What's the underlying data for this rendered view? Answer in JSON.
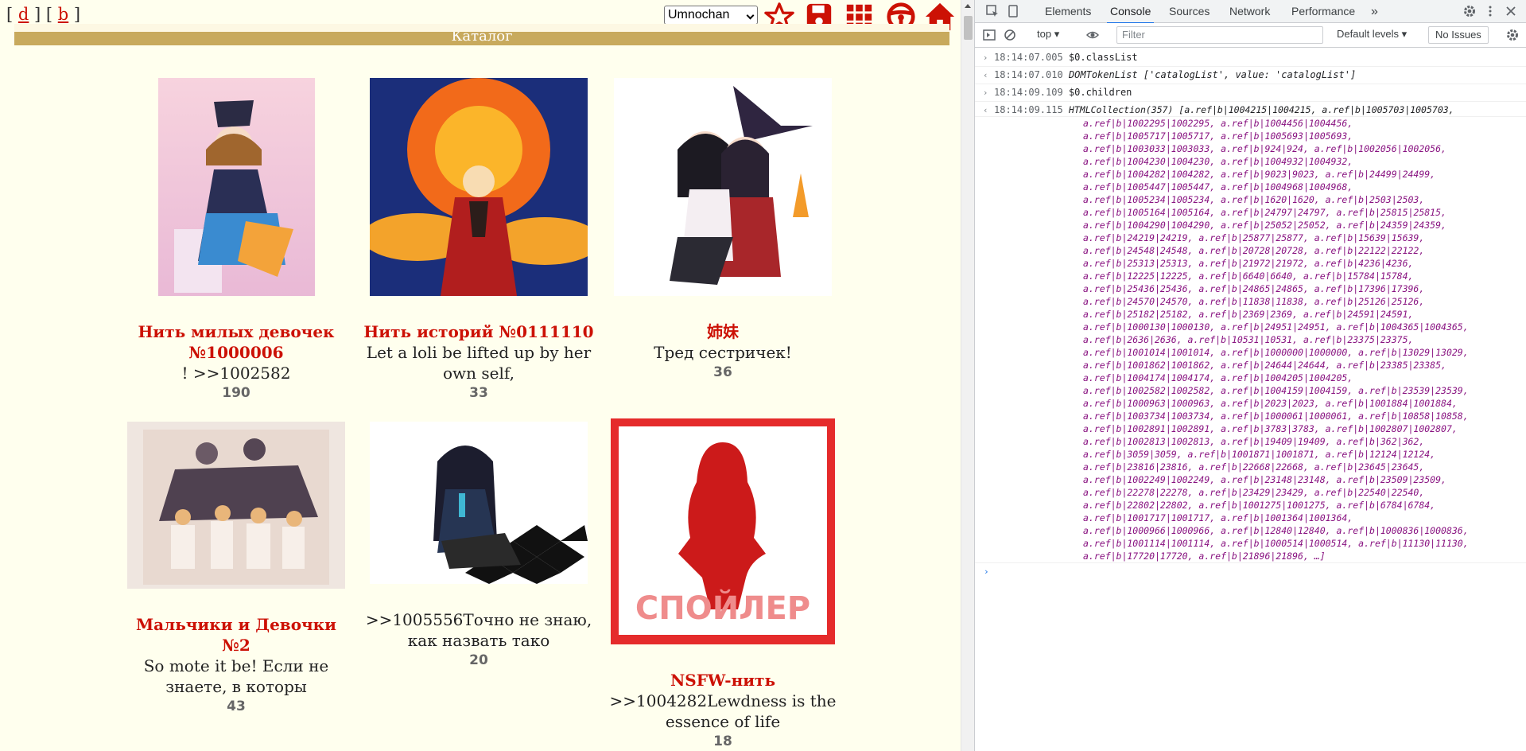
{
  "board": {
    "nav_open": "[ ",
    "nav_d": "d",
    "nav_sep": " ] [ ",
    "nav_b": "b",
    "nav_close": " ]",
    "selected_board": "Umnochan",
    "catalog_title": "Каталог",
    "accent_color": "#cc1105",
    "header_color": "#c8aa5d",
    "threads": [
      {
        "subject": "Нить милых девочек №1000006",
        "comment": "! >>1002582",
        "count": "190"
      },
      {
        "subject": "Нить историй №0111110",
        "comment": "Let a loli be lifted up by her own self,",
        "count": "33"
      },
      {
        "subject": "姉妹",
        "comment": "Тред сестричек!",
        "count": "36"
      },
      {
        "subject": "Мальчики и Девочки №2",
        "comment": "So mote it be! Если не знаете, в которы",
        "count": "43"
      },
      {
        "subject": "",
        "comment": ">>1005556Точно не знаю, как назвать тако",
        "count": "20"
      },
      {
        "subject": "NSFW-нить",
        "comment": ">>1004282Lewdness is the essence of life",
        "count": "18"
      }
    ],
    "spoiler_label": "СПОЙЛЕР"
  },
  "devtools": {
    "tabs": [
      "Elements",
      "Console",
      "Sources",
      "Network",
      "Performance"
    ],
    "active_tab": "Console",
    "more_tabs": "»",
    "context": "top",
    "filter_placeholder": "Filter",
    "levels": "Default levels",
    "issues": "No Issues",
    "log": [
      {
        "kind": "in",
        "ts": "18:14:07.005",
        "text": "$0.classList"
      },
      {
        "kind": "out",
        "ts": "18:14:07.010",
        "text": "DOMTokenList ['catalogList', value: 'catalogList']"
      },
      {
        "kind": "in",
        "ts": "18:14:09.109",
        "text": "$0.children"
      },
      {
        "kind": "out",
        "ts": "18:14:09.115",
        "text": "HTMLCollection(357) [a.ref|b|1004215|1004215, a.ref|b|1005703|1005703,"
      }
    ],
    "collection_lines": [
      "a.ref|b|1002295|1002295, a.ref|b|1004456|1004456,",
      "a.ref|b|1005717|1005717, a.ref|b|1005693|1005693,",
      "a.ref|b|1003033|1003033, a.ref|b|924|924, a.ref|b|1002056|1002056,",
      "a.ref|b|1004230|1004230, a.ref|b|1004932|1004932,",
      "a.ref|b|1004282|1004282, a.ref|b|9023|9023, a.ref|b|24499|24499,",
      "a.ref|b|1005447|1005447, a.ref|b|1004968|1004968,",
      "a.ref|b|1005234|1005234, a.ref|b|1620|1620, a.ref|b|2503|2503,",
      "a.ref|b|1005164|1005164, a.ref|b|24797|24797, a.ref|b|25815|25815,",
      "a.ref|b|1004290|1004290, a.ref|b|25052|25052, a.ref|b|24359|24359,",
      "a.ref|b|24219|24219, a.ref|b|25877|25877, a.ref|b|15639|15639,",
      "a.ref|b|24548|24548, a.ref|b|20728|20728, a.ref|b|22122|22122,",
      "a.ref|b|25313|25313, a.ref|b|21972|21972, a.ref|b|4236|4236,",
      "a.ref|b|12225|12225, a.ref|b|6640|6640, a.ref|b|15784|15784,",
      "a.ref|b|25436|25436, a.ref|b|24865|24865, a.ref|b|17396|17396,",
      "a.ref|b|24570|24570, a.ref|b|11838|11838, a.ref|b|25126|25126,",
      "a.ref|b|25182|25182, a.ref|b|2369|2369, a.ref|b|24591|24591,",
      "a.ref|b|1000130|1000130, a.ref|b|24951|24951, a.ref|b|1004365|1004365,",
      "a.ref|b|2636|2636, a.ref|b|10531|10531, a.ref|b|23375|23375,",
      "a.ref|b|1001014|1001014, a.ref|b|1000000|1000000, a.ref|b|13029|13029,",
      "a.ref|b|1001862|1001862, a.ref|b|24644|24644, a.ref|b|23385|23385,",
      "a.ref|b|1004174|1004174, a.ref|b|1004205|1004205,",
      "a.ref|b|1002582|1002582, a.ref|b|1004159|1004159, a.ref|b|23539|23539,",
      "a.ref|b|1000963|1000963, a.ref|b|2023|2023, a.ref|b|1001884|1001884,",
      "a.ref|b|1003734|1003734, a.ref|b|1000061|1000061, a.ref|b|10858|10858,",
      "a.ref|b|1002891|1002891, a.ref|b|3783|3783, a.ref|b|1002807|1002807,",
      "a.ref|b|1002813|1002813, a.ref|b|19409|19409, a.ref|b|362|362,",
      "a.ref|b|3059|3059, a.ref|b|1001871|1001871, a.ref|b|12124|12124,",
      "a.ref|b|23816|23816, a.ref|b|22668|22668, a.ref|b|23645|23645,",
      "a.ref|b|1002249|1002249, a.ref|b|23148|23148, a.ref|b|23509|23509,",
      "a.ref|b|22278|22278, a.ref|b|23429|23429, a.ref|b|22540|22540,",
      "a.ref|b|22802|22802, a.ref|b|1001275|1001275, a.ref|b|6784|6784,",
      "a.ref|b|1001717|1001717, a.ref|b|1001364|1001364,",
      "a.ref|b|1000966|1000966, a.ref|b|12840|12840, a.ref|b|1000836|1000836,",
      "a.ref|b|1001114|1001114, a.ref|b|1000514|1000514, a.ref|b|11130|11130,",
      "a.ref|b|17720|17720, a.ref|b|21896|21896, …]"
    ],
    "prompt_symbol": "›"
  }
}
